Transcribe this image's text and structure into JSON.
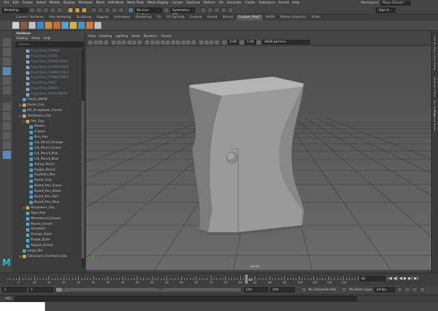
{
  "menubar": {
    "items": [
      "File",
      "Edit",
      "Create",
      "Select",
      "Modify",
      "Display",
      "Windows",
      "Mesh",
      "Edit Mesh",
      "Mesh Tools",
      "Mesh Display",
      "Curves",
      "Surfaces",
      "Deform",
      "UV",
      "Generate",
      "Cache",
      "Substance",
      "Arnold",
      "Help"
    ],
    "workspace_label": "Workspace:",
    "workspace_value": "Maya Classic*"
  },
  "statusline": {
    "mode": "Modeling",
    "live_surface": "No Live Surface",
    "symmetry": "Symmetry: Off",
    "sign_in": "Sign In"
  },
  "shelf": {
    "tabs": [
      "Curves / Surfaces",
      "Poly Modeling",
      "Sculpting",
      "Rigging",
      "Animation",
      "Rendering",
      "FX",
      "FX Caching",
      "Custom",
      "Arnold",
      "Bifrost",
      "Custom_PolyF",
      "MASH",
      "Motion Graphics",
      "XGen"
    ],
    "active_tab": "Custom_PolyF"
  },
  "outliner": {
    "title": "Outliner",
    "menu": [
      "Display",
      "Show",
      "Help"
    ],
    "search_placeholder": "Search...",
    "rows": [
      {
        "label": "Img_Plane_CAM03",
        "indent": 2,
        "kind": "dim"
      },
      {
        "label": "Img_Plane_FOOD",
        "indent": 2,
        "kind": "dim"
      },
      {
        "label": "Img_Plane_FURNITURE1",
        "indent": 2,
        "kind": "dim"
      },
      {
        "label": "Img_Plane_FURNITURE2",
        "indent": 2,
        "kind": "dim"
      },
      {
        "label": "Img_Plane_FURNITURE3",
        "indent": 2,
        "kind": "dim"
      },
      {
        "label": "Img_Plane_FURNITURE4",
        "indent": 2,
        "kind": "dim"
      },
      {
        "label": "Img_Plane_MISC",
        "indent": 2,
        "kind": "dim"
      },
      {
        "label": "Img_Plane_PAPER",
        "indent": 2,
        "kind": "dim"
      },
      {
        "label": "Img_Plane_STATIONERY",
        "indent": 2,
        "kind": "dim"
      },
      {
        "label": "Clock_UNFIN",
        "indent": 1,
        "kind": "mesh"
      },
      {
        "label": "Books_Grp",
        "indent": 1,
        "kind": "grp",
        "tog": "+"
      },
      {
        "label": "Kit_Scrapbook_Closed",
        "indent": 1,
        "kind": "mesh"
      },
      {
        "label": "Stationery_Grp",
        "indent": 1,
        "kind": "grp",
        "tog": "-"
      },
      {
        "label": "Pen_Grp",
        "indent": 2,
        "kind": "grp",
        "tog": "-"
      },
      {
        "label": "Marker",
        "indent": 3,
        "kind": "mesh"
      },
      {
        "label": "Crayon",
        "indent": 3,
        "kind": "mesh"
      },
      {
        "label": "Bics_Pen",
        "indent": 3,
        "kind": "mesh"
      },
      {
        "label": "Col_Pencil_Orange",
        "indent": 3,
        "kind": "mesh"
      },
      {
        "label": "Col_Pencil_Green",
        "indent": 3,
        "kind": "mesh"
      },
      {
        "label": "Col_Pencil_Pink",
        "indent": 3,
        "kind": "mesh"
      },
      {
        "label": "Col_Pencil_Blue",
        "indent": 3,
        "kind": "mesh"
      },
      {
        "label": "Yellow_Pencil",
        "indent": 3,
        "kind": "mesh"
      },
      {
        "label": "Purple_Pencil",
        "indent": 3,
        "kind": "mesh"
      },
      {
        "label": "Fountain_Pen",
        "indent": 3,
        "kind": "mesh"
      },
      {
        "label": "Pencil_Grip",
        "indent": 3,
        "kind": "mesh"
      },
      {
        "label": "Board_Pen_Green",
        "indent": 3,
        "kind": "mesh"
      },
      {
        "label": "Board_Pen_Black",
        "indent": 3,
        "kind": "mesh"
      },
      {
        "label": "Board_Pen_Red",
        "indent": 3,
        "kind": "mesh"
      },
      {
        "label": "Board_Pen_Blue",
        "indent": 3,
        "kind": "mesh"
      },
      {
        "label": "Sharpener_Grp",
        "indent": 2,
        "kind": "grp",
        "tog": "+"
      },
      {
        "label": "Tape_Roll",
        "indent": 2,
        "kind": "mesh"
      },
      {
        "label": "Whiteboard_Eraser",
        "indent": 2,
        "kind": "mesh"
      },
      {
        "label": "Round_Eraser",
        "indent": 2,
        "kind": "mesh"
      },
      {
        "label": "Gluestick",
        "indent": 2,
        "kind": "mesh"
      },
      {
        "label": "Orange_Ruler",
        "indent": 2,
        "kind": "mesh"
      },
      {
        "label": "Purple_Ruler",
        "indent": 2,
        "kind": "mesh"
      },
      {
        "label": "Square_Eraser",
        "indent": 2,
        "kind": "mesh"
      },
      {
        "label": "Large_Bin",
        "indent": 1,
        "kind": "mesh"
      },
      {
        "label": "Classroom_Furniture_Grp",
        "indent": 1,
        "kind": "grp",
        "tog": "+"
      }
    ]
  },
  "viewport": {
    "menu": [
      "View",
      "Shading",
      "Lighting",
      "Show",
      "Renderer",
      "Panels"
    ],
    "near_value": "0.00",
    "far_value": "1.00",
    "color_space": "sRGB gamma",
    "camera_label": "persp"
  },
  "right_strip": [
    "Channel Box / Layer Editor",
    "Attribute Editor",
    "Tool Settings",
    "Modeling Toolkit"
  ],
  "timeline": {
    "tick_labels": [
      "5",
      "10",
      "15",
      "20",
      "25",
      "30",
      "35",
      "40",
      "45",
      "50",
      "55",
      "60",
      "65",
      "70",
      "75",
      "80",
      "85",
      "90",
      "95",
      "100",
      "105",
      "110",
      "115"
    ],
    "current_frame": "82",
    "current_frame_field": "82",
    "play_buttons": [
      "|◀",
      "◀|",
      "◀",
      "▶",
      "▶|",
      "▶|"
    ]
  },
  "range": {
    "start": "1",
    "playback_start": "1",
    "slider_start": "1",
    "slider_end": "120",
    "playback_end": "120",
    "end": "200",
    "character_set": "No Character Set",
    "anim_layer": "No Anim Layer",
    "fps": "24 fps"
  },
  "commandline": {
    "label": "MEL"
  },
  "colors": {
    "accent": "#5d89b6",
    "maya_logo": "#2fb5c9",
    "group_icon": "#c9a64b"
  }
}
